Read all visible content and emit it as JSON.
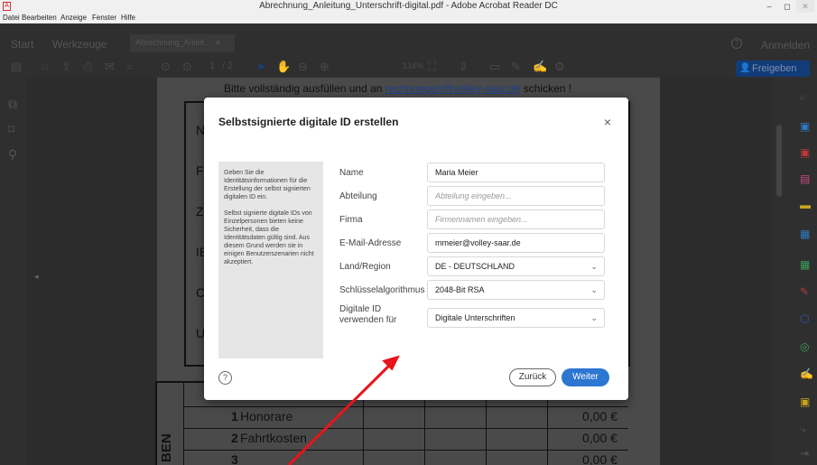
{
  "window": {
    "title": "Abrechnung_Anleitung_Unterschrift-digital.pdf - Adobe Acrobat Reader DC",
    "app_icon_label": "A",
    "minimize": "–",
    "maximize": "◻",
    "close": "✕"
  },
  "menu": [
    "Datei",
    "Bearbeiten",
    "Anzeige",
    "Fenster",
    "Hilfe"
  ],
  "tabs": {
    "start": "Start",
    "tools": "Werkzeuge",
    "document": "Abrechnung_Anleit...",
    "document_close": "×",
    "help": "?",
    "signin": "Anmelden"
  },
  "toolbar": {
    "page_current": "1",
    "page_total": "/ 2",
    "zoom": "134%",
    "share_label": "Freigeben"
  },
  "pdf": {
    "instruction_prefix": "Bitte vollständig ausfüllen und an ",
    "instruction_link": "rechnungen@volley-saar.de",
    "instruction_suffix": " schicken !",
    "box_letters": [
      "N",
      "F",
      "Z",
      "IE",
      "C",
      "U"
    ],
    "side_label": "BEN",
    "rows": [
      {
        "num": "1",
        "label": "Honorare",
        "value": "0,00 €"
      },
      {
        "num": "2",
        "label": "Fahrtkosten",
        "value": "0,00 €"
      },
      {
        "num": "3",
        "label": "",
        "value": "0,00 €"
      }
    ]
  },
  "dialog": {
    "title": "Selbstsignierte digitale ID erstellen",
    "close": "×",
    "info_paragraph_1": "Geben Sie die Identitätsinformationen für die Erstellung der selbst signierten digitalen ID ein.",
    "info_paragraph_2": "Selbst signierte digitale IDs von Einzelpersonen bieten keine Sicherheit, dass die Identitätsdaten gültig sind. Aus diesem Grund werden sie in einigen Benutzerszenarien nicht akzeptiert.",
    "fields": {
      "name": {
        "label": "Name",
        "value": "Maria Meier"
      },
      "department": {
        "label": "Abteilung",
        "placeholder": "Abteilung eingeben..."
      },
      "company": {
        "label": "Firma",
        "placeholder": "Firmennamen eingeben..."
      },
      "email": {
        "label": "E-Mail-Adresse",
        "value": "mmeier@volley-saar.de"
      },
      "country": {
        "label": "Land/Region",
        "value": "DE - DEUTSCHLAND"
      },
      "algorithm": {
        "label": "Schlüsselalgorithmus",
        "value": "2048-Bit RSA"
      },
      "usage": {
        "label": "Digitale ID verwenden für",
        "value": "Digitale Unterschriften"
      }
    },
    "help": "?",
    "back_label": "Zurück",
    "next_label": "Weiter"
  },
  "colors": {
    "primary_button": "#2d76d2",
    "annotation_arrow": "#e8141b",
    "link": "#1e3f8c"
  }
}
